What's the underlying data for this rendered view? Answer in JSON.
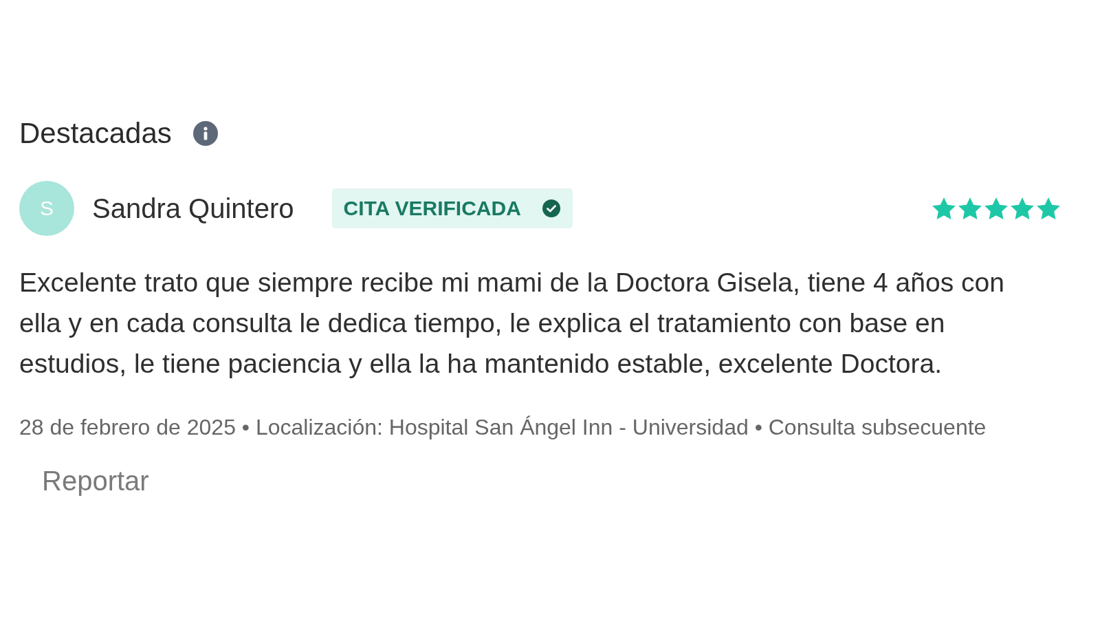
{
  "section": {
    "title": "Destacadas"
  },
  "review": {
    "author": {
      "initial": "S",
      "name": "Sandra Quintero"
    },
    "badge": "CITA VERIFICADA",
    "stars": 5,
    "text": "Excelente trato que siempre recibe mi mami de la Doctora Gisela, tiene 4 años con ella y en cada consulta le dedica tiempo, le explica el tratamiento con base en estudios, le tiene paciencia y ella la ha mantenido estable, excelente Doctora.",
    "meta": "28 de febrero de 2025 • Localización: Hospital San Ángel Inn - Universidad • Consulta subsecuente",
    "report": "Reportar"
  }
}
